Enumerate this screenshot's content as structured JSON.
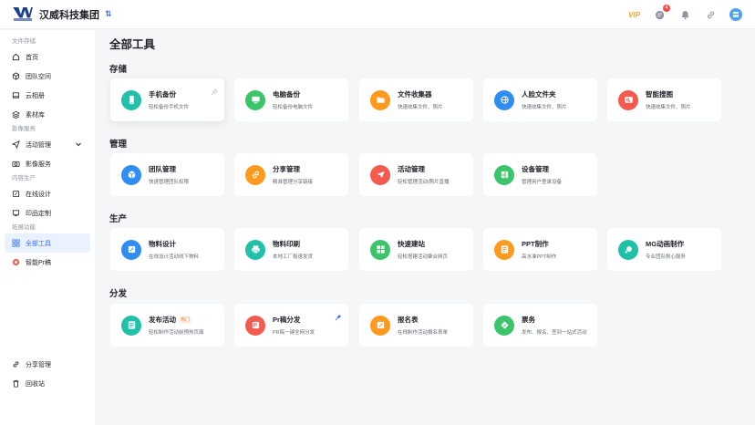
{
  "header": {
    "org_name": "汉威科技集团",
    "switch_icon": "⇅",
    "vip_label": "VIP",
    "notification_count": "4"
  },
  "sidebar": {
    "groups": [
      {
        "title": "文件存储",
        "items": [
          {
            "label": "首页",
            "icon": "home-icon"
          },
          {
            "label": "团队空间",
            "icon": "cube-icon"
          },
          {
            "label": "云相册",
            "icon": "album-icon"
          },
          {
            "label": "素材库",
            "icon": "layers-icon"
          }
        ]
      },
      {
        "title": "影像服务",
        "items": [
          {
            "label": "活动管理",
            "icon": "send-icon"
          },
          {
            "label": "影像服务",
            "icon": "camera-icon"
          }
        ]
      },
      {
        "title": "内容生产",
        "items": [
          {
            "label": "在线设计",
            "icon": "design-icon"
          },
          {
            "label": "印品定制",
            "icon": "print-icon"
          }
        ]
      },
      {
        "title": "拓展功能",
        "items": [
          {
            "label": "全部工具",
            "icon": "grid-icon"
          },
          {
            "label": "智能Pr稿",
            "icon": "pr-icon"
          }
        ]
      }
    ],
    "bottom": [
      {
        "label": "分享管理",
        "icon": "link-icon"
      },
      {
        "label": "回收站",
        "icon": "trash-icon"
      }
    ]
  },
  "main": {
    "title": "全部工具",
    "sections": [
      {
        "title": "存储",
        "cards": [
          {
            "name": "手机备份",
            "desc": "轻松备份手机文件",
            "color": "#21c0a8",
            "icon": "phone-icon"
          },
          {
            "name": "电脑备份",
            "desc": "轻松备份电脑文件",
            "color": "#3cc46a",
            "icon": "computer-icon"
          },
          {
            "name": "文件收集器",
            "desc": "快速收集文件、照片",
            "color": "#ff9a1f",
            "icon": "folder-icon"
          },
          {
            "name": "人脸文件夹",
            "desc": "快速收集文件、照片",
            "color": "#2f8cf0",
            "icon": "face-icon"
          },
          {
            "name": "智能搜图",
            "desc": "快速收集文件、照片",
            "color": "#f55a4e",
            "icon": "image-search-icon"
          }
        ]
      },
      {
        "title": "管理",
        "cards": [
          {
            "name": "团队管理",
            "desc": "快速管理团队权限",
            "color": "#2f8cf0",
            "icon": "team-icon"
          },
          {
            "name": "分享管理",
            "desc": "精准管理分享链接",
            "color": "#ff9a1f",
            "icon": "share-icon"
          },
          {
            "name": "活动管理",
            "desc": "轻松管理活动/照片直播",
            "color": "#f55a4e",
            "icon": "plane-icon"
          },
          {
            "name": "设备管理",
            "desc": "管理用户登录设备",
            "color": "#3cc46a",
            "icon": "device-icon"
          }
        ]
      },
      {
        "title": "生产",
        "cards": [
          {
            "name": "物料设计",
            "desc": "在线设计活动线下物料",
            "color": "#2f8cf0",
            "icon": "material-icon"
          },
          {
            "name": "物料印刷",
            "desc": "本地工厂极速发货",
            "color": "#21c0a8",
            "icon": "printer-icon"
          },
          {
            "name": "快速建站",
            "desc": "轻松搭建活动聚合网页",
            "color": "#3cc46a",
            "icon": "website-icon"
          },
          {
            "name": "PPT制作",
            "desc": "高水准PPT制作",
            "color": "#ff9a1f",
            "icon": "ppt-icon"
          },
          {
            "name": "MG动画制作",
            "desc": "专业团队削心服务",
            "color": "#21c0a8",
            "icon": "animation-icon"
          }
        ]
      },
      {
        "title": "分发",
        "cards": [
          {
            "name": "发布活动",
            "desc": "轻松制作活动前预热页面",
            "color": "#21c0a8",
            "icon": "publish-icon",
            "hot": "热门"
          },
          {
            "name": "Pr稿分发",
            "desc": "PR稿一键全网分发",
            "color": "#f55a4e",
            "icon": "pr-doc-icon"
          },
          {
            "name": "报名表",
            "desc": "在线制作活动报名表单",
            "color": "#ff9a1f",
            "icon": "form-icon"
          },
          {
            "name": "票务",
            "desc": "发布、报名、签到一站式活动",
            "color": "#3cc46a",
            "icon": "ticket-icon"
          }
        ]
      }
    ]
  }
}
